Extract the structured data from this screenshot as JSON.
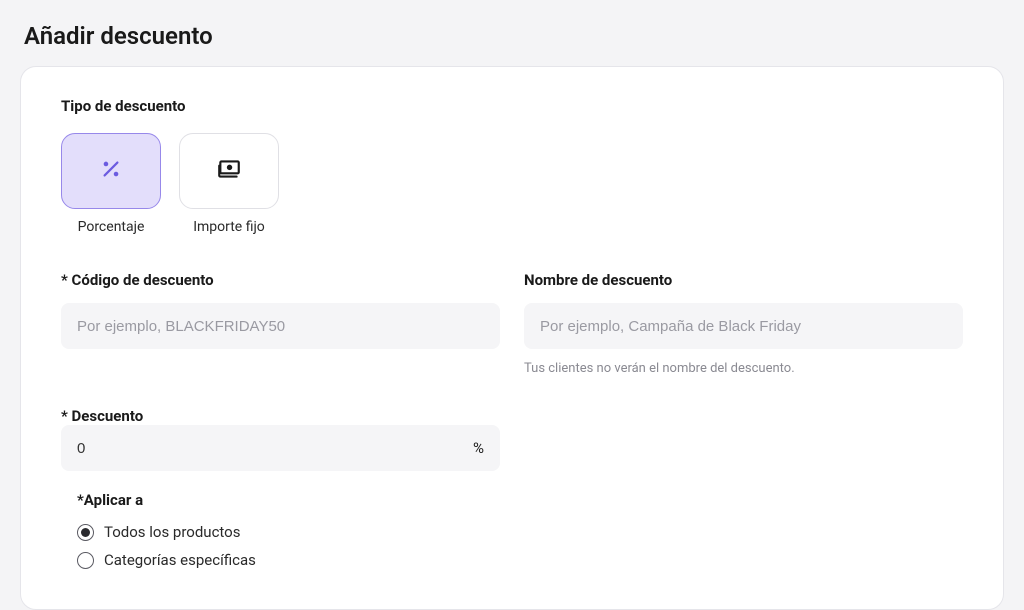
{
  "page_title": "Añadir descuento",
  "discount_type": {
    "label": "Tipo de descuento",
    "options": {
      "percentage": {
        "caption": "Porcentaje"
      },
      "fixed": {
        "caption": "Importe fijo"
      }
    }
  },
  "code_field": {
    "label": "* Código de descuento",
    "placeholder": "Por ejemplo, BLACKFRIDAY50"
  },
  "name_field": {
    "label": "Nombre de descuento",
    "placeholder": "Por ejemplo, Campaña de Black Friday",
    "help": "Tus clientes no verán el nombre del descuento."
  },
  "discount_field": {
    "label": "* Descuento",
    "value": "0",
    "suffix": "%"
  },
  "apply_to": {
    "label": "*Aplicar a",
    "options": {
      "all": "Todos los productos",
      "specific": "Categorías específicas"
    }
  }
}
